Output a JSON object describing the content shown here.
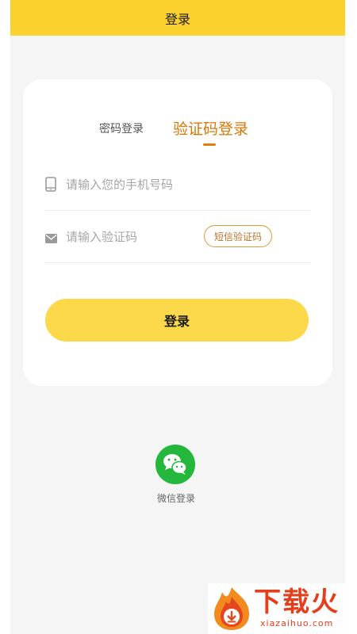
{
  "header": {
    "title": "登录"
  },
  "tabs": [
    {
      "label": "密码登录",
      "active": false
    },
    {
      "label": "验证码登录",
      "active": true
    }
  ],
  "form": {
    "phone": {
      "value": "",
      "placeholder": "请输入您的手机号码",
      "icon": "phone-icon"
    },
    "code": {
      "value": "",
      "placeholder": "请输入验证码",
      "icon": "mail-icon"
    },
    "sms_button_label": "短信验证码",
    "login_label": "登录"
  },
  "social": {
    "wechat_label": "微信登录",
    "wechat_icon": "wechat-icon"
  },
  "watermark": {
    "main": "下载火",
    "sub": "xiazaihuo.com"
  },
  "colors": {
    "accent": "#fcd12e",
    "login_button": "#fcd94a",
    "active_tab": "#d97706",
    "wechat": "#23b83c",
    "background": "#f5f5f5"
  }
}
